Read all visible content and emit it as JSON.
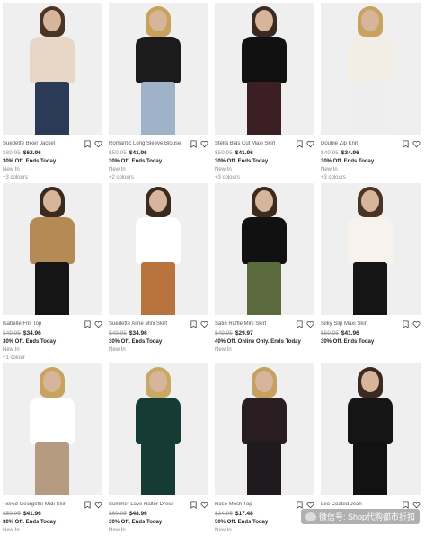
{
  "products": [
    {
      "name": "Suedette Biker Jacket",
      "old_price": "$89.95",
      "price": "$62.96",
      "promo": "30% Off. Ends Today",
      "tag": "New In",
      "colours": "+3 colours",
      "colors": {
        "top": "#e8d6c6",
        "bottom": "#2b3b57",
        "hair": "#4a3426"
      }
    },
    {
      "name": "Romantic Long Sleeve Blouse",
      "old_price": "$59.95",
      "price": "$41.96",
      "promo": "30% Off. Ends Today",
      "tag": "New In",
      "colours": "+2 colours",
      "colors": {
        "top": "#1b1b1b",
        "bottom": "#9fb3c8",
        "hair": "#c8a25a"
      }
    },
    {
      "name": "Stella Bias Cut Maxi Skirt",
      "old_price": "$59.95",
      "price": "$41.96",
      "promo": "30% Off. Ends Today",
      "tag": "New In",
      "colours": "+3 colours",
      "colors": {
        "top": "#111111",
        "bottom": "#3b1f24",
        "hair": "#3a2a22"
      }
    },
    {
      "name": "Double Zip Knit",
      "old_price": "$49.95",
      "price": "$34.96",
      "promo": "30% Off. Ends Today",
      "tag": "New In",
      "colours": "+3 colours",
      "colors": {
        "top": "#f2eee6",
        "bottom": "#eeeeee",
        "hair": "#c9a25e"
      }
    },
    {
      "name": "Isabelle Frill Top",
      "old_price": "$49.95",
      "price": "$34.96",
      "promo": "30% Off. Ends Today",
      "tag": "New In",
      "colours": "+1 colour",
      "colors": {
        "top": "#b58a55",
        "bottom": "#151515",
        "hair": "#3b2a20"
      }
    },
    {
      "name": "Suedette Aline Mini Skirt",
      "old_price": "$49.95",
      "price": "$34.96",
      "promo": "30% Off. Ends Today",
      "tag": "New In",
      "colours": "",
      "colors": {
        "top": "#ffffff",
        "bottom": "#b8743c",
        "hair": "#3a2a20"
      }
    },
    {
      "name": "Satin Ruffle Mini Skirt",
      "old_price": "$49.95",
      "price": "$29.97",
      "promo": "40% Off. Online Only. Ends Today",
      "tag": "New In",
      "colours": "",
      "colors": {
        "top": "#111111",
        "bottom": "#5c6b3e",
        "hair": "#3a2a20"
      }
    },
    {
      "name": "Silky Slip Maxi Skirt",
      "old_price": "$59.95",
      "price": "$41.96",
      "promo": "30% Off. Ends Today",
      "tag": "",
      "colours": "",
      "colors": {
        "top": "#f7f3ec",
        "bottom": "#161616",
        "hair": "#4a3426"
      }
    },
    {
      "name": "Tiered Georgette Midi Skirt",
      "old_price": "$59.95",
      "price": "$41.96",
      "promo": "30% Off. Ends Today",
      "tag": "New In",
      "colours": "",
      "colors": {
        "top": "#ffffff",
        "bottom": "#b59b80",
        "hair": "#c8a35f"
      }
    },
    {
      "name": "Summer Love Halter Dress",
      "old_price": "$69.95",
      "price": "$48.96",
      "promo": "30% Off. Ends Today",
      "tag": "New In",
      "colours": "",
      "colors": {
        "top": "#153b34",
        "bottom": "#153b34",
        "hair": "#c9a863"
      }
    },
    {
      "name": "Rose Mesh Top",
      "old_price": "$34.95",
      "price": "$17.48",
      "promo": "50% Off. Ends Today",
      "tag": "New In",
      "colours": "",
      "colors": {
        "top": "#2a1d22",
        "bottom": "#1f1a1d",
        "hair": "#c5a061"
      }
    },
    {
      "name": "Leo Coated Jean",
      "old_price": "",
      "price": "",
      "promo": "",
      "tag": "",
      "colours": "",
      "colors": {
        "top": "#151515",
        "bottom": "#121212",
        "hair": "#3a2a20"
      }
    }
  ],
  "watermark": "微信号: Shop代购都市折扣",
  "icons": {
    "save": "save-for-later-icon",
    "wishlist": "heart-icon"
  }
}
